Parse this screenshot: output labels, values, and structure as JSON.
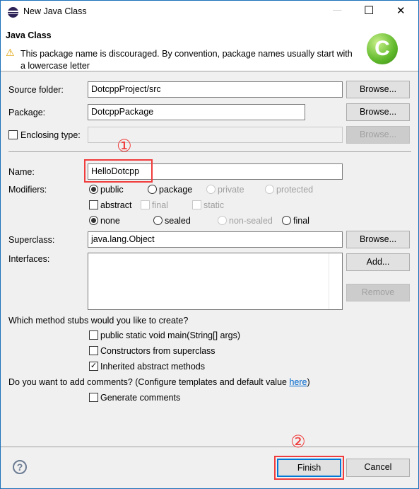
{
  "window": {
    "title": "New Java Class",
    "minimize": "—",
    "maximize": "☐",
    "close": "✕"
  },
  "header": {
    "title": "Java Class",
    "warning": "This package name is discouraged. By convention, package names usually start with a lowercase letter",
    "warning_icon": "warning-triangle-icon",
    "logo_icon": "java-class-c-icon"
  },
  "form": {
    "source_folder": {
      "label": "Source folder:",
      "value": "DotcppProject/src",
      "browse": "Browse..."
    },
    "package": {
      "label": "Package:",
      "value": "DotcppPackage",
      "browse": "Browse..."
    },
    "enclosing": {
      "label": "Enclosing type:",
      "value": "",
      "browse": "Browse...",
      "checked": false
    },
    "name": {
      "label": "Name:",
      "value": "HelloDotcpp"
    },
    "modifiers": {
      "label": "Modifiers:",
      "access": [
        "public",
        "package",
        "private",
        "protected"
      ],
      "access_selected": "public",
      "abstract": "abstract",
      "final": "final",
      "static": "static",
      "sealing": [
        "none",
        "sealed",
        "non-sealed",
        "final"
      ],
      "sealing_selected": "none"
    },
    "superclass": {
      "label": "Superclass:",
      "value": "java.lang.Object",
      "browse": "Browse..."
    },
    "interfaces": {
      "label": "Interfaces:",
      "add": "Add...",
      "remove": "Remove"
    },
    "stubs": {
      "question": "Which method stubs would you like to create?",
      "items": [
        {
          "label": "public static void main(String[] args)",
          "checked": false
        },
        {
          "label": "Constructors from superclass",
          "checked": false
        },
        {
          "label": "Inherited abstract methods",
          "checked": true
        }
      ]
    },
    "comments": {
      "question": "Do you want to add comments? (Configure templates and default value ",
      "link": "here",
      "close": ")",
      "item": "Generate comments",
      "checked": false
    }
  },
  "annotations": {
    "step1": "①",
    "step2": "②",
    "color": "#f03c3c"
  },
  "footer": {
    "finish": "Finish",
    "cancel": "Cancel",
    "help_icon": "help-icon"
  }
}
